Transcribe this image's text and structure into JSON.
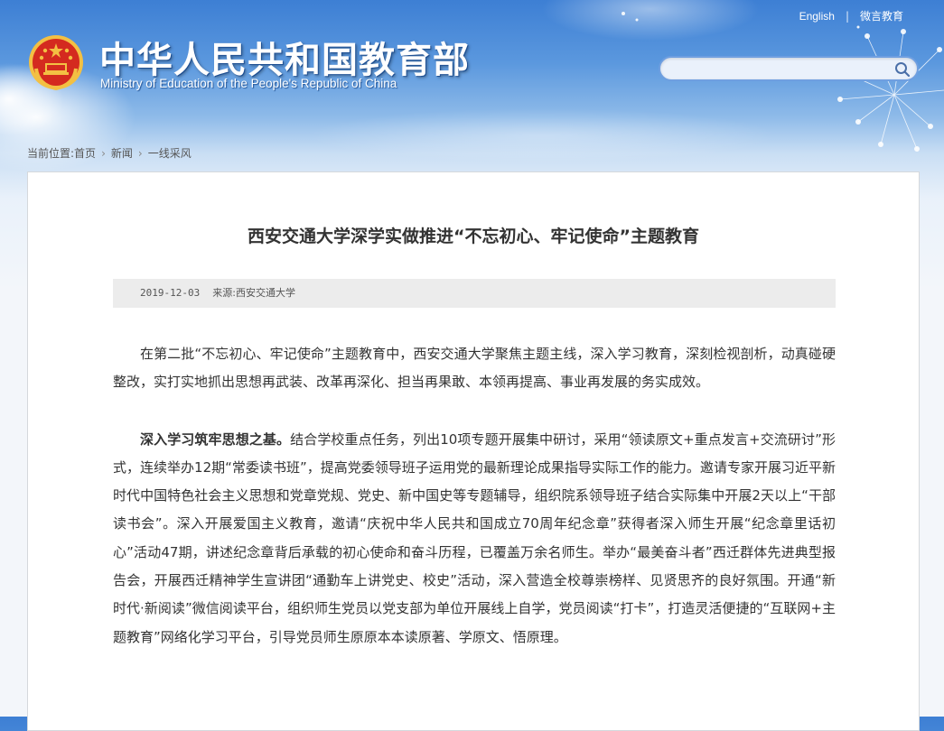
{
  "header": {
    "site_title": "中华人民共和国教育部",
    "site_subtitle": "Ministry of Education of the People's Republic of China",
    "top_links": {
      "english": "English",
      "separator": "|",
      "weibo": "微言教育"
    }
  },
  "search": {
    "placeholder": "",
    "value": ""
  },
  "breadcrumb": {
    "prefix": "当前位置:",
    "items": [
      "首页",
      "新闻",
      "一线采风"
    ]
  },
  "article": {
    "title": "西安交通大学深学实做推进“不忘初心、牢记使命”主题教育",
    "date": "2019-12-03",
    "source": "来源:西安交通大学",
    "paragraph1": "在第二批“不忘初心、牢记使命”主题教育中，西安交通大学聚焦主题主线，深入学习教育，深刻检视剖析，动真碰硬整改，实打实地抓出思想再武装、改革再深化、担当再果敢、本领再提高、事业再发展的务实成效。",
    "paragraph2_lead": "深入学习筑牢思想之基。",
    "paragraph2_text": "结合学校重点任务，列出10项专题开展集中研讨，采用“领读原文+重点发言+交流研讨”形式，连续举办12期“常委读书班”，提高党委领导班子运用党的最新理论成果指导实际工作的能力。邀请专家开展习近平新时代中国特色社会主义思想和党章党规、党史、新中国史等专题辅导，组织院系领导班子结合实际集中开展2天以上“干部读书会”。深入开展爱国主义教育，邀请“庆祝中华人民共和国成立70周年纪念章”获得者深入师生开展“纪念章里话初心”活动47期，讲述纪念章背后承载的初心使命和奋斗历程，已覆盖万余名师生。举办“最美奋斗者”西迁群体先进典型报告会，开展西迁精神学生宣讲团“通勤车上讲党史、校史”活动，深入营造全校尊崇榜样、见贤思齐的良好氛围。开通“新时代·新阅读”微信阅读平台，组织师生党员以党支部为单位开展线上自学，党员阅读“打卡”，打造灵活便捷的“互联网+主题教育”网络化学习平台，引导党员师生原原本本读原著、学原文、悟原理。"
  },
  "colors": {
    "sky_top": "#3d7fd4",
    "title_text": "#333333",
    "emblem_red": "#d42a1f",
    "emblem_gold": "#f3c043"
  },
  "icons": {
    "emblem": "national-emblem-icon",
    "search": "search-icon",
    "chevron": "chevron-right-icon"
  }
}
